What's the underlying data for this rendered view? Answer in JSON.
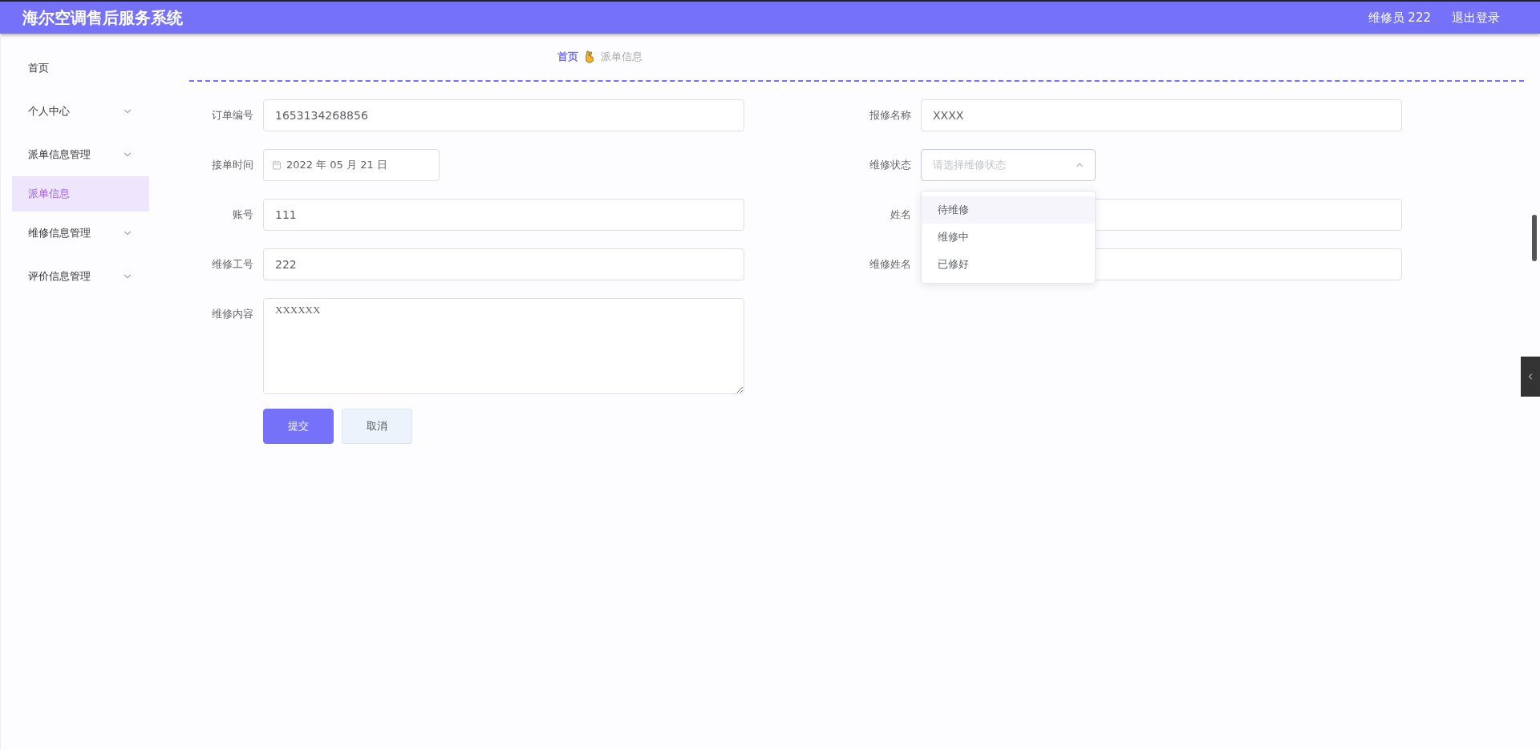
{
  "header": {
    "title": "海尔空调售后服务系统",
    "user": "维修员 222",
    "logout": "退出登录"
  },
  "sidebar": {
    "items": [
      {
        "label": "首页",
        "has_submenu": false,
        "selected": false
      },
      {
        "label": "个人中心",
        "has_submenu": true,
        "selected": false
      },
      {
        "label": "派单信息管理",
        "has_submenu": true,
        "selected": false
      },
      {
        "label": "派单信息",
        "has_submenu": false,
        "selected": true
      },
      {
        "label": "维修信息管理",
        "has_submenu": true,
        "selected": false
      },
      {
        "label": "评价信息管理",
        "has_submenu": true,
        "selected": false
      }
    ]
  },
  "breadcrumb": [
    {
      "label": "首页",
      "current": false
    },
    {
      "label": "派单信息",
      "current": true
    }
  ],
  "form": {
    "columns": [
      [
        {
          "label": "订单编号",
          "kind": "text",
          "value": "1653134268856"
        },
        {
          "label": "接单时间",
          "kind": "date",
          "value": "2022 年 05 月 21 日"
        },
        {
          "label": "账号",
          "kind": "text",
          "value": "111"
        },
        {
          "label": "维修工号",
          "kind": "text",
          "value": "222"
        },
        {
          "label": "维修内容",
          "kind": "textarea",
          "value": "XXXXXX"
        }
      ],
      [
        {
          "label": "报修名称",
          "kind": "text",
          "value": "XXXX"
        },
        {
          "label": "维修状态",
          "kind": "select",
          "placeholder": "请选择维修状态",
          "open": true,
          "options": [
            {
              "label": "待维修",
              "highlighted": true
            },
            {
              "label": "维修中",
              "highlighted": false
            },
            {
              "label": "已修好",
              "highlighted": false
            }
          ]
        },
        {
          "label": "姓名",
          "kind": "text"
        },
        {
          "label": "维修姓名",
          "kind": "text"
        }
      ]
    ],
    "buttons": [
      {
        "label": "提交",
        "kind": "primary"
      },
      {
        "label": "取消",
        "kind": "default"
      }
    ]
  }
}
